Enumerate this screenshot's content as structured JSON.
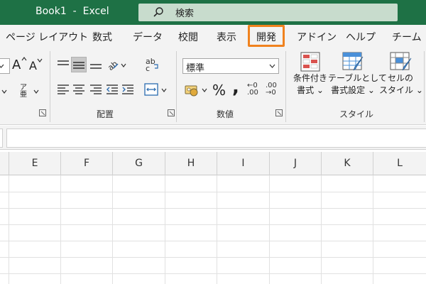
{
  "window": {
    "title": "Book1  -  Excel"
  },
  "search": {
    "label": "検索"
  },
  "tabs": [
    {
      "label": "ページ レイアウト"
    },
    {
      "label": "数式"
    },
    {
      "label": "データ"
    },
    {
      "label": "校閲"
    },
    {
      "label": "表示"
    },
    {
      "label": "開発",
      "highlighted": true
    },
    {
      "label": "アドイン"
    },
    {
      "label": "ヘルプ"
    },
    {
      "label": "チーム"
    }
  ],
  "ribbon": {
    "font_grow_label": "A",
    "font_shrink_label": "A",
    "phonetic_label": "ア亜",
    "alignment": {
      "group_label": "配置",
      "wrap_label": "ab c"
    },
    "number": {
      "group_label": "数値",
      "format_value": "標準",
      "percent_label": "%",
      "comma_label": ",",
      "inc_decimal_label": "←0 .00",
      "dec_decimal_label": ".00 →0"
    },
    "styles": {
      "group_label": "スタイル",
      "conditional": {
        "line1": "条件付き",
        "line2": "書式 ⌄"
      },
      "table": {
        "line1": "テーブルとして",
        "line2": "書式設定 ⌄"
      },
      "cell": {
        "line1": "セルの",
        "line2": "スタイル ⌄"
      }
    }
  },
  "grid": {
    "columns": [
      "E",
      "F",
      "G",
      "H",
      "I",
      "J",
      "K",
      "L"
    ]
  },
  "colors": {
    "title_bar": "#1e7145",
    "search_box": "#c8dccd",
    "highlight": "#f0821e",
    "ribbon_bg": "#f3f3f3"
  }
}
